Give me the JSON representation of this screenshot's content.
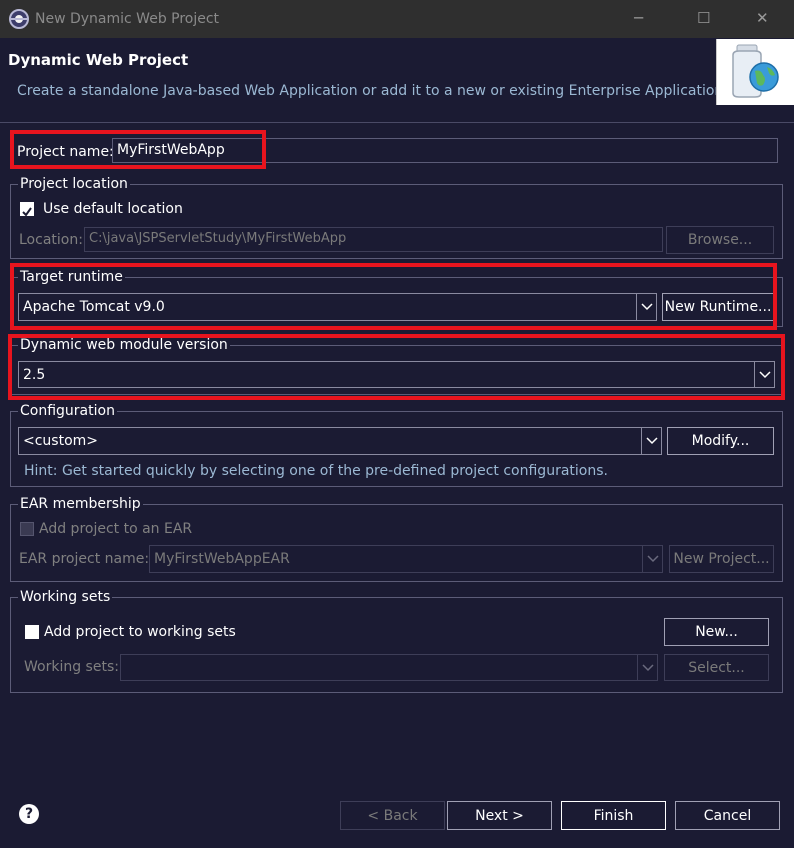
{
  "window": {
    "title": "New Dynamic Web Project",
    "minimize_glyph": "─",
    "maximize_glyph": "☐",
    "close_glyph": "✕"
  },
  "header": {
    "title": "Dynamic Web Project",
    "description": "Create a standalone Java-based Web Application or add it to a new or existing Enterprise Application."
  },
  "project_name": {
    "label": "Project name:",
    "value": "MyFirstWebApp"
  },
  "project_location": {
    "legend": "Project location",
    "use_default_label": "Use default location",
    "use_default_checked": true,
    "location_label": "Location:",
    "location_value": "C:\\java\\JSPServletStudy\\MyFirstWebApp",
    "browse_label": "Browse..."
  },
  "target_runtime": {
    "legend": "Target runtime",
    "selected": "Apache Tomcat v9.0",
    "new_runtime_label": "New Runtime..."
  },
  "module_version": {
    "legend": "Dynamic web module version",
    "selected": "2.5"
  },
  "configuration": {
    "legend": "Configuration",
    "selected": "<custom>",
    "modify_label": "Modify...",
    "hint": "Hint: Get started quickly by selecting one of the pre-defined project configurations."
  },
  "ear_membership": {
    "legend": "EAR membership",
    "add_to_ear_label": "Add project to an EAR",
    "add_to_ear_checked": false,
    "ear_name_label": "EAR project name:",
    "ear_name_value": "MyFirstWebAppEAR",
    "new_project_label": "New Project..."
  },
  "working_sets": {
    "legend": "Working sets",
    "add_label": "Add project to working sets",
    "add_checked": false,
    "new_label": "New...",
    "sets_label": "Working sets:",
    "sets_value": "",
    "select_label": "Select..."
  },
  "footer": {
    "help_glyph": "?",
    "back_label": "< Back",
    "next_label": "Next >",
    "finish_label": "Finish",
    "cancel_label": "Cancel"
  },
  "colors": {
    "background": "#1b1b33",
    "highlight_box": "#e8141e",
    "hint_text": "#9bb8d3"
  }
}
